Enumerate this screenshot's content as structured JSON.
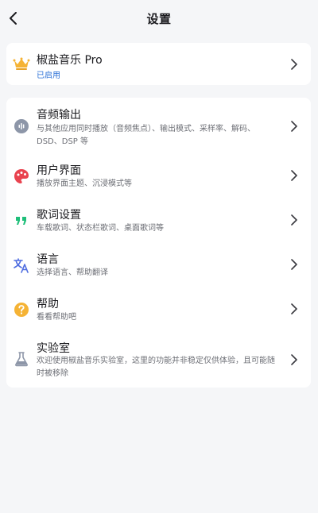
{
  "header": {
    "title": "设置"
  },
  "pro": {
    "label": "椒盐音乐 Pro",
    "status": "已启用",
    "status_color": "#2a6fd6",
    "icon": "crown-icon"
  },
  "settings": [
    {
      "name": "audio-output",
      "label": "音频输出",
      "desc": "与其他应用同时播放（音频焦点）、输出模式、采样率、解码、DSD、DSP 等",
      "icon": "audio-wave-icon"
    },
    {
      "name": "user-interface",
      "label": "用户界面",
      "desc": "播放界面主题、沉浸模式等",
      "icon": "palette-icon"
    },
    {
      "name": "lyrics-settings",
      "label": "歌词设置",
      "desc": "车载歌词、状态栏歌词、桌面歌词等",
      "icon": "quote-icon"
    },
    {
      "name": "language",
      "label": "语言",
      "desc": "选择语言、帮助翻译",
      "icon": "translate-icon"
    },
    {
      "name": "help",
      "label": "帮助",
      "desc": "看看帮助吧",
      "icon": "help-icon"
    },
    {
      "name": "lab",
      "label": "实验室",
      "desc": "欢迎使用椒盐音乐实验室，这里的功能并非稳定仅供体验，且可能随时被移除",
      "icon": "flask-icon"
    }
  ]
}
